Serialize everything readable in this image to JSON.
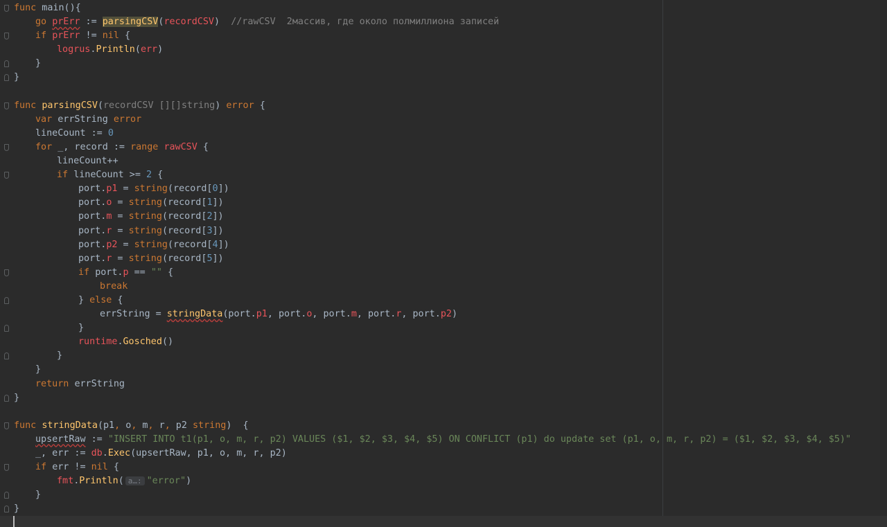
{
  "editor": {
    "language": "Go",
    "lines": [
      {
        "fold": "open",
        "indent": 0,
        "t": [
          [
            "kw",
            "func"
          ],
          [
            "plain",
            " main(){"
          ]
        ]
      },
      {
        "indent": 1,
        "t": [
          [
            "kw",
            "go "
          ],
          [
            "red sq",
            "prErr"
          ],
          [
            "plain",
            " := "
          ],
          [
            "fn hl",
            "parsingCSV"
          ],
          [
            "plain",
            "("
          ],
          [
            "red",
            "recordCSV"
          ],
          [
            "plain",
            ")  "
          ],
          [
            "cmt",
            "//rawCSV  2массив, где около полмиллиона записей"
          ]
        ]
      },
      {
        "fold": "open",
        "indent": 1,
        "t": [
          [
            "kw",
            "if "
          ],
          [
            "red",
            "prErr"
          ],
          [
            "plain",
            " != "
          ],
          [
            "kw",
            "nil"
          ],
          [
            "plain",
            " {"
          ]
        ]
      },
      {
        "indent": 2,
        "t": [
          [
            "pkg",
            "logrus"
          ],
          [
            "plain",
            "."
          ],
          [
            "fn",
            "Println"
          ],
          [
            "plain",
            "("
          ],
          [
            "red",
            "err"
          ],
          [
            "plain",
            ")"
          ]
        ]
      },
      {
        "fold": "close",
        "indent": 1,
        "t": [
          [
            "plain",
            "}"
          ]
        ]
      },
      {
        "fold": "close",
        "indent": 0,
        "t": [
          [
            "plain",
            "}"
          ]
        ]
      },
      {
        "indent": 0,
        "t": []
      },
      {
        "fold": "open",
        "indent": 0,
        "t": [
          [
            "kw",
            "func "
          ],
          [
            "fn",
            "parsingCSV"
          ],
          [
            "plain",
            "("
          ],
          [
            "cmt",
            "recordCSV [][]string"
          ],
          [
            "plain",
            ") "
          ],
          [
            "kw",
            "error"
          ],
          [
            "plain",
            " {"
          ]
        ]
      },
      {
        "indent": 1,
        "t": [
          [
            "kw",
            "var "
          ],
          [
            "plain",
            "errString "
          ],
          [
            "kw",
            "error"
          ]
        ]
      },
      {
        "indent": 1,
        "t": [
          [
            "plain",
            "lineCount := "
          ],
          [
            "num",
            "0"
          ]
        ]
      },
      {
        "fold": "open",
        "indent": 1,
        "t": [
          [
            "kw",
            "for "
          ],
          [
            "plain",
            "_, record := "
          ],
          [
            "kw",
            "range "
          ],
          [
            "red",
            "rawCSV"
          ],
          [
            "plain",
            " {"
          ]
        ]
      },
      {
        "indent": 2,
        "t": [
          [
            "plain",
            "lineCount++"
          ]
        ]
      },
      {
        "fold": "open",
        "indent": 2,
        "t": [
          [
            "kw",
            "if "
          ],
          [
            "plain",
            "lineCount >= "
          ],
          [
            "num",
            "2"
          ],
          [
            "plain",
            " {"
          ]
        ]
      },
      {
        "indent": 3,
        "t": [
          [
            "plain",
            "port."
          ],
          [
            "fld",
            "p1"
          ],
          [
            "plain",
            " = "
          ],
          [
            "kw",
            "string"
          ],
          [
            "plain",
            "(record["
          ],
          [
            "num",
            "0"
          ],
          [
            "plain",
            "])"
          ]
        ]
      },
      {
        "indent": 3,
        "t": [
          [
            "plain",
            "port."
          ],
          [
            "fld",
            "o"
          ],
          [
            "plain",
            " = "
          ],
          [
            "kw",
            "string"
          ],
          [
            "plain",
            "(record["
          ],
          [
            "num",
            "1"
          ],
          [
            "plain",
            "])"
          ]
        ]
      },
      {
        "indent": 3,
        "t": [
          [
            "plain",
            "port."
          ],
          [
            "fld",
            "m"
          ],
          [
            "plain",
            " = "
          ],
          [
            "kw",
            "string"
          ],
          [
            "plain",
            "(record["
          ],
          [
            "num",
            "2"
          ],
          [
            "plain",
            "])"
          ]
        ]
      },
      {
        "indent": 3,
        "t": [
          [
            "plain",
            "port."
          ],
          [
            "fld",
            "r"
          ],
          [
            "plain",
            " = "
          ],
          [
            "kw",
            "string"
          ],
          [
            "plain",
            "(record["
          ],
          [
            "num",
            "3"
          ],
          [
            "plain",
            "])"
          ]
        ]
      },
      {
        "indent": 3,
        "t": [
          [
            "plain",
            "port."
          ],
          [
            "fld",
            "p2"
          ],
          [
            "plain",
            " = "
          ],
          [
            "kw",
            "string"
          ],
          [
            "plain",
            "(record["
          ],
          [
            "num",
            "4"
          ],
          [
            "plain",
            "])"
          ]
        ]
      },
      {
        "indent": 3,
        "t": [
          [
            "plain",
            "port."
          ],
          [
            "fld",
            "r"
          ],
          [
            "plain",
            " = "
          ],
          [
            "kw",
            "string"
          ],
          [
            "plain",
            "(record["
          ],
          [
            "num",
            "5"
          ],
          [
            "plain",
            "])"
          ]
        ]
      },
      {
        "fold": "open",
        "indent": 3,
        "t": [
          [
            "kw",
            "if "
          ],
          [
            "plain",
            "port."
          ],
          [
            "fld",
            "p"
          ],
          [
            "plain",
            " == "
          ],
          [
            "str",
            "\"\""
          ],
          [
            "plain",
            " {"
          ]
        ]
      },
      {
        "indent": 4,
        "t": [
          [
            "kw",
            "break"
          ]
        ]
      },
      {
        "fold": "close",
        "indent": 3,
        "t": [
          [
            "plain",
            "} "
          ],
          [
            "kw",
            "else"
          ],
          [
            "plain",
            " {"
          ]
        ]
      },
      {
        "indent": 4,
        "t": [
          [
            "plain",
            "errString = "
          ],
          [
            "fn sq",
            "stringData"
          ],
          [
            "plain",
            "(port."
          ],
          [
            "fld",
            "p1"
          ],
          [
            "plain",
            ", port."
          ],
          [
            "fld",
            "o"
          ],
          [
            "plain",
            ", port."
          ],
          [
            "fld",
            "m"
          ],
          [
            "plain",
            ", port."
          ],
          [
            "fld",
            "r"
          ],
          [
            "plain",
            ", port."
          ],
          [
            "fld",
            "p2"
          ],
          [
            "plain",
            ")"
          ]
        ]
      },
      {
        "fold": "close",
        "indent": 3,
        "t": [
          [
            "plain",
            "}"
          ]
        ]
      },
      {
        "indent": 3,
        "t": [
          [
            "pkg",
            "runtime"
          ],
          [
            "plain",
            "."
          ],
          [
            "fn",
            "Gosched"
          ],
          [
            "plain",
            "()"
          ]
        ]
      },
      {
        "fold": "close",
        "indent": 2,
        "t": [
          [
            "plain",
            "}"
          ]
        ]
      },
      {
        "indent": 1,
        "t": [
          [
            "plain",
            "}"
          ]
        ]
      },
      {
        "indent": 1,
        "t": [
          [
            "kw",
            "return "
          ],
          [
            "plain",
            "errString"
          ]
        ]
      },
      {
        "fold": "close",
        "indent": 0,
        "t": [
          [
            "plain",
            "}"
          ]
        ]
      },
      {
        "indent": 0,
        "t": []
      },
      {
        "fold": "open",
        "indent": 0,
        "t": [
          [
            "kw",
            "func "
          ],
          [
            "fn",
            "stringData"
          ],
          [
            "plain",
            "(p1"
          ],
          [
            "kw",
            ","
          ],
          [
            "plain",
            " o"
          ],
          [
            "kw",
            ","
          ],
          [
            "plain",
            " m"
          ],
          [
            "kw",
            ","
          ],
          [
            "plain",
            " r"
          ],
          [
            "kw",
            ","
          ],
          [
            "plain",
            " p2 "
          ],
          [
            "kw",
            "string"
          ],
          [
            "plain",
            ")  {"
          ]
        ]
      },
      {
        "indent": 1,
        "t": [
          [
            "plain sq",
            "upsertRaw"
          ],
          [
            "plain",
            " := "
          ],
          [
            "str",
            "\"INSERT INTO t1(p1, o, m, r, p2) VALUES ($1, $2, $3, $4, $5) ON CONFLICT (p1) do update set (p1, o, m, r, p2) = ($1, $2, $3, $4, $5)\""
          ]
        ]
      },
      {
        "indent": 1,
        "t": [
          [
            "plain",
            "_, err := "
          ],
          [
            "pkg",
            "db"
          ],
          [
            "plain",
            "."
          ],
          [
            "fn",
            "Exec"
          ],
          [
            "plain",
            "(upsertRaw, p1, o, m, r, p2)"
          ]
        ]
      },
      {
        "fold": "open",
        "indent": 1,
        "t": [
          [
            "kw",
            "if "
          ],
          [
            "plain",
            "err != "
          ],
          [
            "kw",
            "nil"
          ],
          [
            "plain",
            " {"
          ]
        ]
      },
      {
        "indent": 2,
        "t": [
          [
            "pkg",
            "fmt"
          ],
          [
            "plain",
            "."
          ],
          [
            "fn",
            "Println"
          ],
          [
            "plain",
            "("
          ],
          [
            "hint",
            "a…:"
          ],
          [
            "str",
            "\"error\""
          ],
          [
            "plain",
            ")"
          ]
        ]
      },
      {
        "fold": "close",
        "indent": 1,
        "t": [
          [
            "plain",
            "}"
          ]
        ]
      },
      {
        "fold": "close",
        "indent": 0,
        "t": [
          [
            "plain",
            "}"
          ]
        ]
      },
      {
        "indent": 0,
        "current": true,
        "t": []
      }
    ]
  }
}
